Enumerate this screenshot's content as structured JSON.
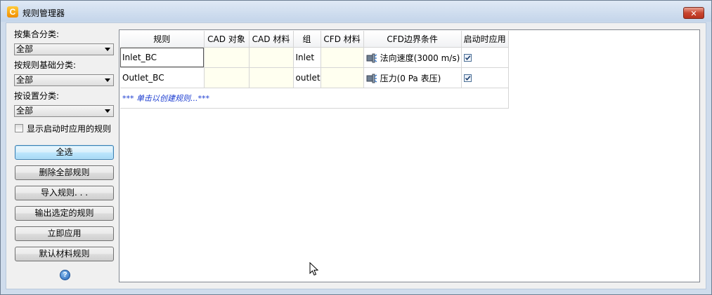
{
  "window": {
    "title": "规则管理器",
    "close_label": "✕"
  },
  "left": {
    "collection_label": "按集合分类:",
    "collection_value": "全部",
    "base_label": "按规则基础分类:",
    "base_value": "全部",
    "settings_label": "按设置分类:",
    "settings_value": "全部",
    "show_startup_label": "显示启动时应用的规则",
    "show_startup_checked": false,
    "buttons": {
      "select_all": "全选",
      "delete_all": "删除全部规则",
      "import": "导入规则. . .",
      "export_selected": "输出选定的规则",
      "apply_now": "立即应用",
      "default_material": "默认材料规则"
    }
  },
  "grid": {
    "headers": [
      "规则",
      "CAD 对象",
      "CAD 材料",
      "组",
      "CFD 材料",
      "CFD边界条件",
      "启动时应用"
    ],
    "rows": [
      {
        "rule": "Inlet_BC",
        "cad_object": "",
        "cad_material": "",
        "group": "Inlet",
        "cfd_material": "",
        "cfd_bc": "法向速度(3000 m/s)",
        "apply_on_startup": true
      },
      {
        "rule": "Outlet_BC",
        "cad_object": "",
        "cad_material": "",
        "group": "outlet",
        "cfd_material": "",
        "cfd_bc": "压力(0 Pa 表压)",
        "apply_on_startup": true
      }
    ],
    "create_row_text": "*** 单击以创建规则...***"
  },
  "icons": {
    "app": "app-logo-icon",
    "help": "help-icon",
    "boundary": "boundary-condition-icon",
    "checkbox": "check-icon"
  },
  "colors": {
    "title_bg": "#c4d5ea",
    "yellow_cell": "#fffff0",
    "create_link": "#1a3bd0",
    "close_button": "#c8452f"
  }
}
